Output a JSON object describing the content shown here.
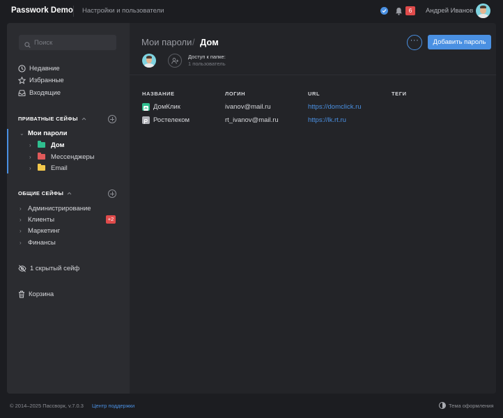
{
  "app": {
    "brand": "Passwork Demo",
    "top_link": "Настройки и пользователи",
    "notifications_count": "6",
    "user_name": "Андрей Иванов"
  },
  "colors": {
    "accent": "#4a90e2",
    "badge": "#e04b4b",
    "folder_home": "#2fbf8f",
    "folder_messengers": "#e05a5a",
    "folder_email": "#f2c84b"
  },
  "sidebar": {
    "search_placeholder": "Поиск",
    "quick": [
      {
        "label": "Недавние",
        "icon": "clock-icon"
      },
      {
        "label": "Избранные",
        "icon": "star-icon"
      },
      {
        "label": "Входящие",
        "icon": "inbox-icon"
      }
    ],
    "private_title": "ПРИВАТНЫЕ СЕЙФЫ",
    "private_vault": "Мои пароли",
    "folders": [
      {
        "label": "Дом",
        "color": "#2fbf8f",
        "active": true
      },
      {
        "label": "Мессенджеры",
        "color": "#e05a5a"
      },
      {
        "label": "Email",
        "color": "#f2c84b"
      }
    ],
    "shared_title": "ОБЩИЕ СЕЙФЫ",
    "shared": [
      {
        "label": "Администрирование"
      },
      {
        "label": "Клиенты",
        "badge": "+2"
      },
      {
        "label": "Маркетинг"
      },
      {
        "label": "Финансы"
      }
    ],
    "hidden_label": "1 скрытый сейф",
    "trash_label": "Корзина"
  },
  "main": {
    "breadcrumb_parent": "Мои пароли",
    "breadcrumb_sep": "/",
    "breadcrumb_current": "Дом",
    "more_label": "···",
    "add_button": "Добавить пароль",
    "access_title": "Доступ к папке:",
    "access_sub": "1 пользователь",
    "columns": [
      "НАЗВАНИЕ",
      "ЛОГИН",
      "URL",
      "ТЕГИ"
    ],
    "rows": [
      {
        "name": "ДомКлик",
        "login": "ivanov@mail.ru",
        "url": "https://domclick.ru",
        "favicon": "#2fbf8f"
      },
      {
        "name": "Ростелеком",
        "login": "rt_ivanov@mail.ru",
        "url": "https://lk.rt.ru",
        "favicon": "#b0b2b8"
      }
    ]
  },
  "footer": {
    "copyright": "© 2014–2025 Пассворк, v.7.0.3",
    "support": "Центр поддержки",
    "theme": "Тема оформления"
  }
}
